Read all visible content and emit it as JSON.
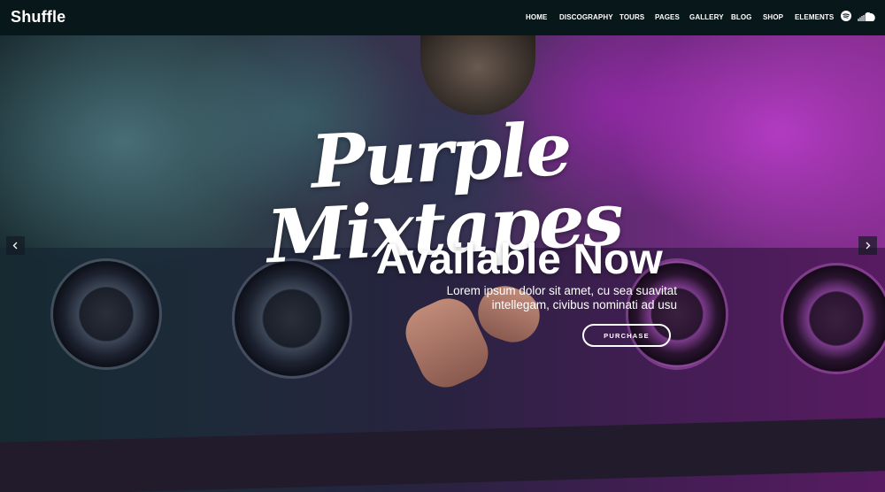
{
  "header": {
    "logo": "Shuffle",
    "nav": [
      {
        "label": "HOME"
      },
      {
        "label": "DISCOGRAPHY"
      },
      {
        "label": "TOURS"
      },
      {
        "label": "PAGES"
      },
      {
        "label": "GALLERY"
      },
      {
        "label": "BLOG"
      },
      {
        "label": "SHOP"
      },
      {
        "label": "ELEMENTS"
      }
    ],
    "social_icons": [
      "spotify-icon",
      "soundcloud-icon"
    ]
  },
  "hero": {
    "script_title": "Purple Mixtapes",
    "headline": "Available Now",
    "subtext_line1": "Lorem ipsum dolor sit amet, cu sea suavitat",
    "subtext_line2": "intellegam, civibus nominati ad usu",
    "button_label": "PURCHASE",
    "arrows": [
      "chevron-left-icon",
      "chevron-right-icon"
    ]
  },
  "colors": {
    "header_bg": "#081719",
    "text": "#ffffff",
    "accent_purple": "#8a2f94",
    "accent_teal": "#3a5a62"
  }
}
